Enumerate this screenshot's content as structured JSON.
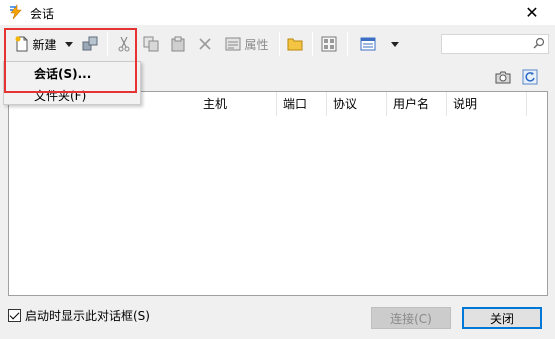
{
  "window": {
    "title": "会话",
    "app_icon": "lightning-icon",
    "close_icon": "close-icon"
  },
  "toolbar": {
    "new_label": "新建",
    "search_value": "",
    "icons": [
      "new-doc-icon",
      "dropdown-arrow-icon",
      "connect-icon",
      "cut-icon",
      "copy-icon",
      "paste-icon",
      "delete-icon",
      "properties-icon",
      "folder-icon",
      "session-icon",
      "view-icon",
      "dropdown-arrow-icon",
      "search-icon"
    ],
    "properties_label": "属性"
  },
  "dropdown": {
    "items": [
      {
        "label": "会话(S)..."
      },
      {
        "label": "文件夹(F)"
      }
    ]
  },
  "subbar": {
    "icons": [
      "camera-icon",
      "refresh-icon"
    ]
  },
  "table": {
    "columns": [
      "主机",
      "端口",
      "协议",
      "用户名",
      "说明"
    ]
  },
  "footer": {
    "checkbox_label": "启动时显示此对话框(S)",
    "checkbox_checked": true,
    "connect_label": "连接(C)",
    "close_label": "关闭"
  },
  "colors": {
    "highlight": "#e53333",
    "accent": "#0078d7"
  }
}
